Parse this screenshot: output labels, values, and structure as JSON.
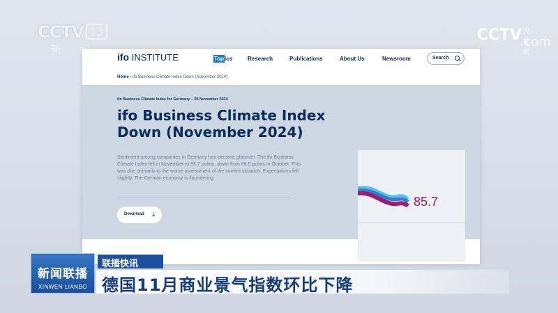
{
  "broadcast": {
    "channel_logo": "CCTV",
    "channel_number": "13",
    "channel_name": "新 闻",
    "watermark_logo": "CCTV",
    "watermark_sub": "央视网",
    "watermark_domain": ".com",
    "program_cn": "新闻联播",
    "program_pinyin": "XINWEN LIANBO",
    "segment_label": "联播快讯",
    "headline": "德国11月商业景气指数环比下降"
  },
  "site": {
    "logo_bold": "ifo",
    "logo_rest": " INSTITUTE",
    "nav": {
      "topics_hl": "Top",
      "topics_rest": "ics",
      "research": "Research",
      "publications": "Publications",
      "about": "About Us",
      "newsroom": "Newsroom"
    },
    "search_placeholder": "Search"
  },
  "breadcrumb": {
    "home": "Home",
    "separator": "›",
    "current": "ifo Business Climate Index Down (November 2024)"
  },
  "article": {
    "kicker": "ifo Business Climate Index for Germany – 25 November 2024",
    "title": "ifo Business Climate Index Down (November 2024)",
    "summary": "Sentiment among companies in Germany has become gloomier. The ifo Business Climate Index fell in November to 85.7 points, down from 86.5 points in October. This was due primarily to the worse assessment of the current situation. Expectations fell slightly. The German economy is floundering.",
    "download_label": "Download",
    "download_icon": "download-icon"
  },
  "chart_data": {
    "type": "line",
    "value_label": "85.7",
    "series_colors": [
      "#9e1b72",
      "#2b7fd0",
      "#5cc0e6"
    ]
  }
}
